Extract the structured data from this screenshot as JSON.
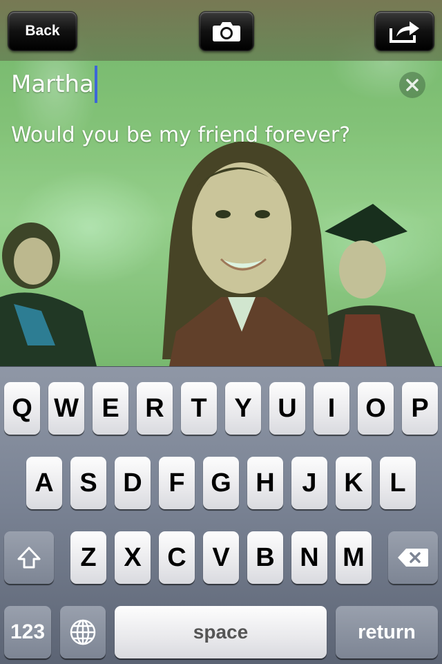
{
  "toolbar": {
    "back_label": "Back",
    "camera_icon": "camera-icon",
    "share_icon": "share-icon"
  },
  "card": {
    "name_value": "Martha",
    "message_value": "Would you be my friend forever?",
    "clear_icon": "clear-icon"
  },
  "keyboard": {
    "row1": [
      "Q",
      "W",
      "E",
      "R",
      "T",
      "Y",
      "U",
      "I",
      "O",
      "P"
    ],
    "row2": [
      "A",
      "S",
      "D",
      "F",
      "G",
      "H",
      "J",
      "K",
      "L"
    ],
    "row3": [
      "Z",
      "X",
      "C",
      "V",
      "B",
      "N",
      "M"
    ],
    "shift_icon": "shift-icon",
    "delete_icon": "delete-icon",
    "numbers_label": "123",
    "globe_icon": "globe-icon",
    "space_label": "space",
    "return_label": "return"
  },
  "colors": {
    "caret": "#3c66d8",
    "text_overlay": "#ffffff",
    "photo_tint": "#4fbf5a"
  }
}
